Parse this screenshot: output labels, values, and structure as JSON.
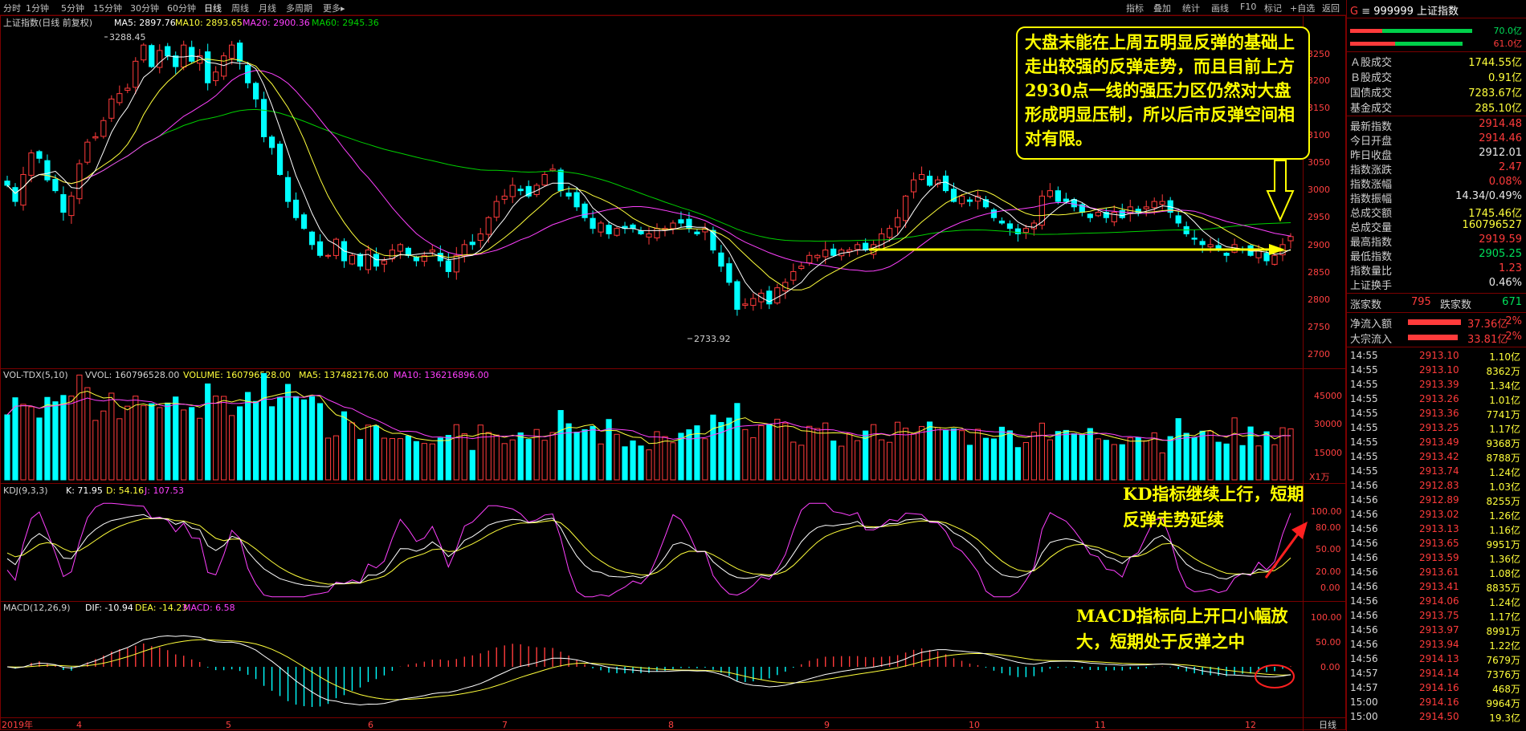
{
  "toolbar": {
    "periods": [
      "分时",
      "1分钟",
      "5分钟",
      "15分钟",
      "30分钟",
      "60分钟",
      "日线",
      "周线",
      "月线",
      "多周期",
      "更多▸"
    ],
    "active": "日线",
    "right_tools": [
      "指标",
      "叠加",
      "统计",
      "画线",
      "F10",
      "标记",
      "+自选",
      "返回"
    ]
  },
  "colors": {
    "up": "#ff3b3b",
    "down": "#00ffff",
    "ma5": "#ffffff",
    "ma10": "#ffff3b",
    "ma20": "#ff40ff",
    "ma60": "#00d000",
    "annot": "#ffff00"
  },
  "price_panel": {
    "name": "上证指数(日线 前复权)",
    "ma_legend": [
      {
        "label": "MA5: 2897.76",
        "color": "#ffffff"
      },
      {
        "label": "MA10: 2893.65",
        "color": "#ffff3b"
      },
      {
        "label": "MA20: 2900.36",
        "color": "#ff40ff"
      },
      {
        "label": "MA60: 2945.36",
        "color": "#00d000"
      }
    ],
    "high_label": "3288.45",
    "low_label": "2733.92",
    "yticks": [
      "3250",
      "3200",
      "3150",
      "3100",
      "3050",
      "3000",
      "2950",
      "2900",
      "2850",
      "2800",
      "2750",
      "2700"
    ],
    "annotation": "大盘未能在上周五明显反弹的基础上走出较强的反弹走势，而且目前上方2930点一线的强压力区仍然对大盘形成明显压制，所以后市反弹空间相对有限。"
  },
  "vol_panel": {
    "legend": [
      {
        "label": "VOL-TDX(5,10)",
        "color": "#d0d0d0"
      },
      {
        "label": "VVOL: 160796528.00",
        "color": "#d0d0d0"
      },
      {
        "label": "VOLUME: 160796528.00",
        "color": "#ffff3b"
      },
      {
        "label": "MA5: 137482176.00",
        "color": "#ffff3b"
      },
      {
        "label": "MA10: 136216896.00",
        "color": "#ff40ff"
      }
    ],
    "yticks": [
      "45000",
      "30000",
      "15000"
    ],
    "unit": "X1万"
  },
  "kdj_panel": {
    "legend": [
      {
        "label": "KDJ(9,3,3)",
        "color": "#d0d0d0"
      },
      {
        "label": "K: 71.95",
        "color": "#ffffff"
      },
      {
        "label": "D: 54.16",
        "color": "#ffff3b"
      },
      {
        "label": "J: 107.53",
        "color": "#ff40ff"
      }
    ],
    "yticks": [
      "100.00",
      "80.00",
      "50.00",
      "20.00",
      "0.00"
    ],
    "annotation": "KD指标继续上行，短期反弹走势延续"
  },
  "macd_panel": {
    "legend": [
      {
        "label": "MACD(12,26,9)",
        "color": "#d0d0d0"
      },
      {
        "label": "DIF: -10.94",
        "color": "#ffffff"
      },
      {
        "label": "DEA: -14.23",
        "color": "#ffff3b"
      },
      {
        "label": "MACD: 6.58",
        "color": "#ff40ff"
      }
    ],
    "yticks": [
      "100.00",
      "50.00",
      "0.00"
    ],
    "annotation": "MACD指标向上开口小幅放大，短期处于反弹之中"
  },
  "time_axis": {
    "labels": [
      "2019年",
      "4",
      "5",
      "6",
      "7",
      "8",
      "9",
      "10",
      "11",
      "12"
    ],
    "right_label": "日线"
  },
  "chart_data": {
    "type": "candlestick",
    "title": "上证指数(日线 前复权)",
    "ylim": [
      2690,
      3300
    ],
    "bars": 161,
    "closes": [
      3010,
      2980,
      3030,
      3070,
      3060,
      3020,
      3000,
      2960,
      2990,
      3050,
      3090,
      3100,
      3130,
      3170,
      3180,
      3190,
      3240,
      3270,
      3230,
      3260,
      3250,
      3230,
      3270,
      3240,
      3250,
      3200,
      3220,
      3250,
      3270,
      3240,
      3200,
      3170,
      3100,
      3080,
      3030,
      2980,
      2950,
      2930,
      2900,
      2880,
      2880,
      2910,
      2870,
      2880,
      2860,
      2890,
      2860,
      2870,
      2890,
      2900,
      2880,
      2870,
      2880,
      2890,
      2870,
      2850,
      2880,
      2900,
      2900,
      2920,
      2950,
      2980,
      2990,
      3010,
      3000,
      2990,
      3010,
      3030,
      3040,
      3000,
      2990,
      2970,
      2950,
      2930,
      2940,
      2920,
      2930,
      2930,
      2930,
      2920,
      2920,
      2930,
      2930,
      2940,
      2940,
      2930,
      2920,
      2930,
      2890,
      2860,
      2830,
      2780,
      2790,
      2800,
      2810,
      2790,
      2820,
      2830,
      2850,
      2860,
      2880,
      2880,
      2890,
      2880,
      2890,
      2890,
      2900,
      2890,
      2900,
      2920,
      2930,
      2950,
      2990,
      3020,
      3030,
      3010,
      3020,
      3000,
      2980,
      2990,
      2980,
      2990,
      2970,
      2950,
      2940,
      2930,
      2920,
      2930,
      2940,
      2990,
      3000,
      2980,
      2980,
      2970,
      2960,
      2950,
      2960,
      2950,
      2960,
      2950,
      2970,
      2960,
      2970,
      2980,
      2980,
      2960,
      2940,
      2920,
      2910,
      2900,
      2900,
      2890,
      2880,
      2900,
      2890,
      2880,
      2890,
      2870,
      2880,
      2900,
      2915
    ],
    "volume_unit": "万",
    "annotation_levels": {
      "resistance": 2930,
      "support_line": 2900
    }
  },
  "sidebar": {
    "code": "999999",
    "name": "上证指数",
    "g": "G",
    "bar_vals": [
      "70.0亿",
      "61.0亿"
    ],
    "stats": [
      {
        "k": "Ａ股成交",
        "v": "1744.55亿",
        "c": "yel"
      },
      {
        "k": "Ｂ股成交",
        "v": "0.91亿",
        "c": "yel"
      },
      {
        "k": "国债成交",
        "v": "7283.67亿",
        "c": "yel"
      },
      {
        "k": "基金成交",
        "v": "285.10亿",
        "c": "yel"
      }
    ],
    "quote": [
      {
        "k": "最新指数",
        "v": "2914.48",
        "c": "red"
      },
      {
        "k": "今日开盘",
        "v": "2914.46",
        "c": "red"
      },
      {
        "k": "昨日收盘",
        "v": "2912.01",
        "c": "wht"
      },
      {
        "k": "指数涨跌",
        "v": "2.47",
        "c": "red"
      },
      {
        "k": "指数涨幅",
        "v": "0.08%",
        "c": "red"
      },
      {
        "k": "指数振幅",
        "v": "14.34/0.49%",
        "c": "wht"
      },
      {
        "k": "总成交额",
        "v": "1745.46亿",
        "c": "yel"
      },
      {
        "k": "总成交量",
        "v": "160796527",
        "c": "yel"
      },
      {
        "k": "最高指数",
        "v": "2919.59",
        "c": "red"
      },
      {
        "k": "最低指数",
        "v": "2905.25",
        "c": "grn"
      },
      {
        "k": "指数量比",
        "v": "1.23",
        "c": "red"
      },
      {
        "k": "上证换手",
        "v": "0.46%",
        "c": "wht"
      }
    ],
    "adv_label": "涨家数",
    "adv": "795",
    "dec_label": "跌家数",
    "dec": "671",
    "flows": [
      {
        "k": "净流入额",
        "v": "37.36亿",
        "p": "2%"
      },
      {
        "k": "大宗流入",
        "v": "33.81亿",
        "p": "2%"
      }
    ],
    "ticks": [
      {
        "t": "14:55",
        "p": "2913.10",
        "a": "1.10亿"
      },
      {
        "t": "14:55",
        "p": "2913.10",
        "a": "8362万"
      },
      {
        "t": "14:55",
        "p": "2913.39",
        "a": "1.34亿"
      },
      {
        "t": "14:55",
        "p": "2913.26",
        "a": "1.01亿"
      },
      {
        "t": "14:55",
        "p": "2913.36",
        "a": "7741万"
      },
      {
        "t": "14:55",
        "p": "2913.25",
        "a": "1.17亿"
      },
      {
        "t": "14:55",
        "p": "2913.49",
        "a": "9368万"
      },
      {
        "t": "14:55",
        "p": "2913.42",
        "a": "8788万"
      },
      {
        "t": "14:55",
        "p": "2913.74",
        "a": "1.24亿"
      },
      {
        "t": "14:56",
        "p": "2912.83",
        "a": "1.03亿"
      },
      {
        "t": "14:56",
        "p": "2912.89",
        "a": "8255万"
      },
      {
        "t": "14:56",
        "p": "2913.02",
        "a": "1.26亿"
      },
      {
        "t": "14:56",
        "p": "2913.13",
        "a": "1.16亿"
      },
      {
        "t": "14:56",
        "p": "2913.65",
        "a": "9951万"
      },
      {
        "t": "14:56",
        "p": "2913.59",
        "a": "1.36亿"
      },
      {
        "t": "14:56",
        "p": "2913.61",
        "a": "1.08亿"
      },
      {
        "t": "14:56",
        "p": "2913.41",
        "a": "8835万"
      },
      {
        "t": "14:56",
        "p": "2914.06",
        "a": "1.24亿"
      },
      {
        "t": "14:56",
        "p": "2913.75",
        "a": "1.17亿"
      },
      {
        "t": "14:56",
        "p": "2913.97",
        "a": "8991万"
      },
      {
        "t": "14:56",
        "p": "2913.94",
        "a": "1.22亿"
      },
      {
        "t": "14:56",
        "p": "2914.13",
        "a": "7679万"
      },
      {
        "t": "14:57",
        "p": "2914.14",
        "a": "7376万"
      },
      {
        "t": "14:57",
        "p": "2914.16",
        "a": "468万"
      },
      {
        "t": "15:00",
        "p": "2914.16",
        "a": "9964万"
      },
      {
        "t": "15:00",
        "p": "2914.50",
        "a": "19.3亿"
      }
    ]
  }
}
